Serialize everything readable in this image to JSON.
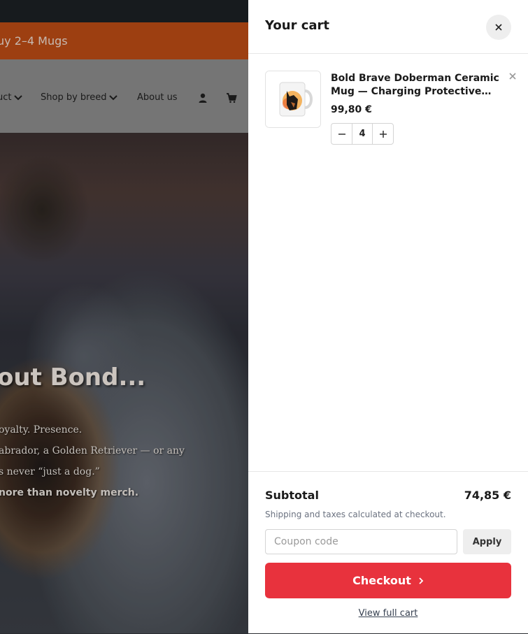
{
  "background_site": {
    "promo_text": "uy 2–4 Mugs",
    "nav": {
      "item_product": "uct",
      "item_shop_by_breed": "Shop by breed",
      "item_about": "About us",
      "account_icon": "user-icon",
      "cart_icon": "cart-icon"
    },
    "hero": {
      "title": "out Bond...",
      "lines": [
        "oyalty. Presence.",
        "abrador, a Golden Retriever — or any",
        "s never “just a dog.”",
        "nore than novelty merch."
      ]
    }
  },
  "cart": {
    "title": "Your cart",
    "close_icon": "close-icon",
    "items": [
      {
        "name": "Bold Brave Doberman Ceramic Mug — Charging Protective…",
        "price": "99,80 €",
        "quantity": "4",
        "thumbnail": "doberman-mug-image"
      }
    ],
    "subtotal_label": "Subtotal",
    "subtotal_value": "74,85 €",
    "shipping_note": "Shipping and taxes calculated at checkout.",
    "coupon_placeholder": "Coupon code",
    "apply_label": "Apply",
    "checkout_label": "Checkout",
    "view_cart_label": "View full cart"
  },
  "colors": {
    "checkout": "#e8323d",
    "promo_bar": "#b94a14"
  }
}
